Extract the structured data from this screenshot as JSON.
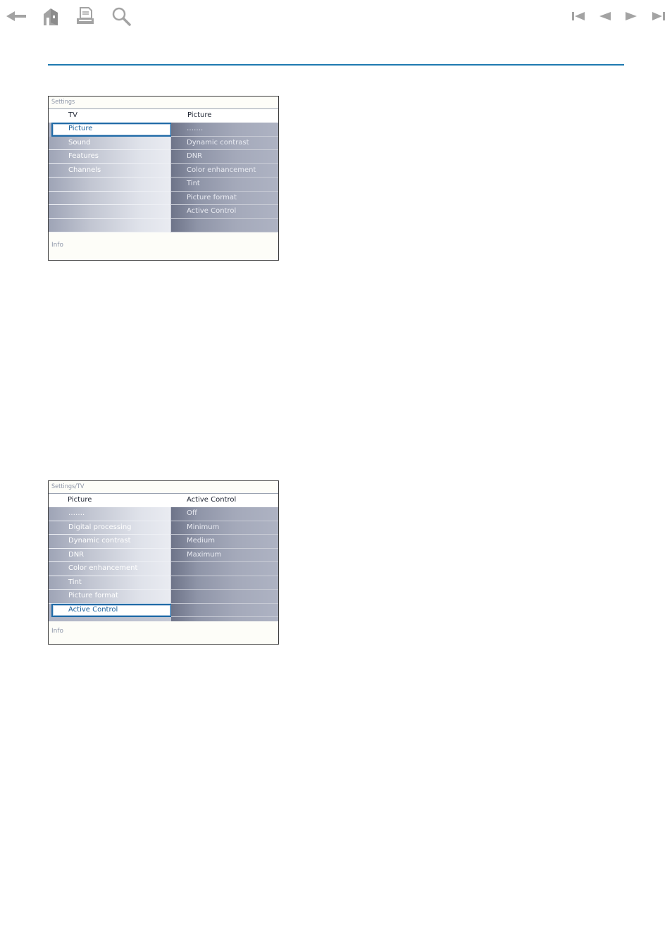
{
  "toolbar": {
    "left": [
      {
        "name": "back-arrow-icon"
      },
      {
        "name": "home-icon"
      },
      {
        "name": "print-icon"
      },
      {
        "name": "search-icon"
      }
    ],
    "right": [
      {
        "name": "first-page-icon"
      },
      {
        "name": "previous-page-icon"
      },
      {
        "name": "next-page-icon"
      },
      {
        "name": "last-page-icon"
      }
    ],
    "icon_color": "#a3a3a3",
    "rule_color": "#1e7ab0"
  },
  "screen1": {
    "breadcrumb": "Settings",
    "left_header": "TV",
    "right_header": "Picture",
    "left_items": [
      "Picture",
      "Sound",
      "Features",
      "Channels",
      "",
      "",
      "",
      ""
    ],
    "selected_index": 0,
    "right_items": [
      "…….",
      "Dynamic contrast",
      "DNR",
      "Color enhancement",
      "Tint",
      "Picture format",
      "Active Control",
      ""
    ],
    "info": "Info"
  },
  "screen2": {
    "breadcrumb": "Settings/TV",
    "left_header": "Picture",
    "right_header": "Active Control",
    "left_items": [
      "…….",
      "Digital processing",
      "Dynamic contrast",
      "DNR",
      "Color enhancement",
      "Tint",
      "Picture format",
      "Active Control"
    ],
    "selected_index": 7,
    "right_items": [
      "Off",
      "Minimum",
      "Medium",
      "Maximum",
      "",
      "",
      "",
      ""
    ],
    "info": "Info"
  },
  "colors": {
    "selected_text": "#1a5f9a",
    "selected_border": "#1f6aa7",
    "panel_border": "#3b3b3b",
    "breadcrumb_text": "#8f97a9"
  }
}
